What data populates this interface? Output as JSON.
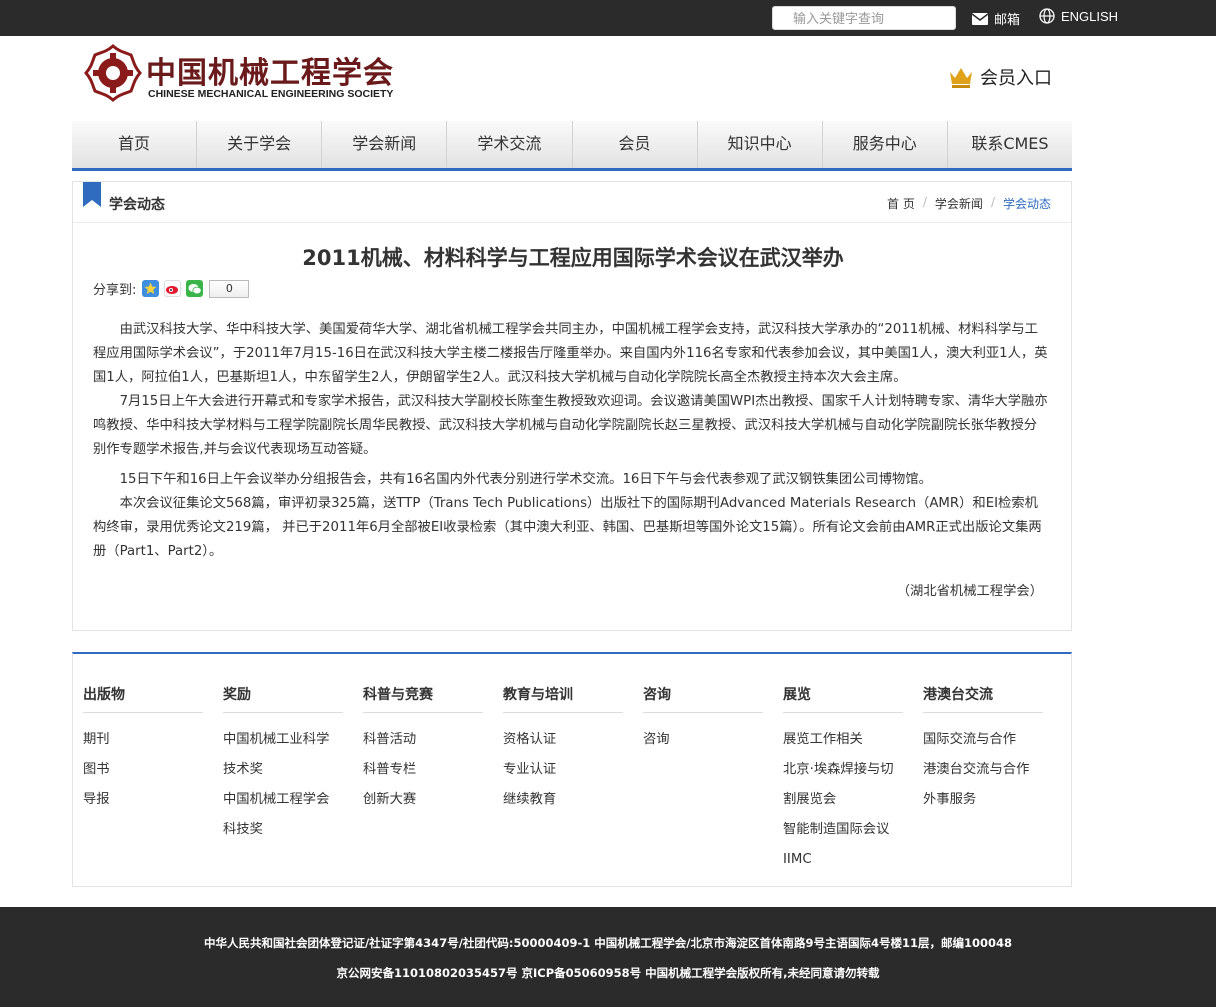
{
  "topbar": {
    "search_placeholder": "输入关键字查询",
    "mail_label": "邮箱",
    "lang_label": "ENGLISH"
  },
  "header": {
    "logo_title": "中国机械工程学会",
    "logo_subtitle": "CHINESE MECHANICAL ENGINEERING SOCIETY",
    "member_entry": "会员入口"
  },
  "nav": {
    "items": [
      "首页",
      "关于学会",
      "学会新闻",
      "学术交流",
      "会员",
      "知识中心",
      "服务中心",
      "联系CMES"
    ]
  },
  "section": {
    "title": "学会动态",
    "breadcrumb": [
      "首 页",
      "学会新闻",
      "学会动态"
    ]
  },
  "article": {
    "title": "2011机械、材料科学与工程应用国际学术会议在武汉举办",
    "share_label": "分享到:",
    "share_count": "0",
    "paragraphs": [
      "由武汉科技大学、华中科技大学、美国爱荷华大学、湖北省机械工程学会共同主办，中国机械工程学会支持，武汉科技大学承办的“2011机械、材料科学与工程应用国际学术会议”，于2011年7月15-16日在武汉科技大学主楼二楼报告厅隆重举办。来自国内外116名专家和代表参加会议，其中美国1人，澳大利亚1人，英国1人，阿拉伯1人，巴基斯坦1人，中东留学生2人，伊朗留学生2人。武汉科技大学机械与自动化学院院长高全杰教授主持本次大会主席。",
      "7月15日上午大会进行开幕式和专家学术报告，武汉科技大学副校长陈奎生教授致欢迎词。会议邀请美国WPI杰出教授、国家千人计划特聘专家、清华大学融亦鸣教授、华中科技大学材料与工程学院副院长周华民教授、武汉科技大学机械与自动化学院副院长赵三星教授、武汉科技大学机械与自动化学院副院长张华教授分别作专题学术报告,并与会议代表现场互动答疑。",
      "15日下午和16日上午会议举办分组报告会，共有16名国内外代表分别进行学术交流。16日下午与会代表参观了武汉钢铁集团公司博物馆。",
      "本次会议征集论文568篇，审评初录325篇，送TTP（Trans Tech Publications）出版社下的国际期刊Advanced Materials Research（AMR）和EI检索机构终审，录用优秀论文219篇， 并已于2011年6月全部被EI收录检索（其中澳大利亚、韩国、巴基斯坦等国外论文15篇）。所有论文会前由AMR正式出版论文集两册（Part1、Part2）。"
    ],
    "signature": "（湖北省机械工程学会）"
  },
  "footer_columns": [
    {
      "title": "出版物",
      "items": [
        "期刊",
        "图书",
        "导报"
      ]
    },
    {
      "title": "奖励",
      "items": [
        "中国机械工业科学",
        "技术奖",
        "中国机械工程学会",
        "科技奖"
      ]
    },
    {
      "title": "科普与竞赛",
      "items": [
        "科普活动",
        "科普专栏",
        "创新大赛"
      ]
    },
    {
      "title": "教育与培训",
      "items": [
        "资格认证",
        "专业认证",
        "继续教育"
      ]
    },
    {
      "title": "咨询",
      "items": [
        "咨询"
      ]
    },
    {
      "title": "展览",
      "items": [
        "展览工作相关",
        "北京·埃森焊接与切",
        "割展览会",
        "智能制造国际会议",
        "IIMC"
      ]
    },
    {
      "title": "港澳台交流",
      "items": [
        "国际交流与合作",
        "港澳台交流与合作",
        "外事服务"
      ]
    }
  ],
  "bottom": {
    "line1": "中华人民共和国社会团体登记证/社证字第4347号/社团代码:50000409-1 中国机械工程学会/北京市海淀区首体南路9号主语国际4号楼11层，邮编100048",
    "line2": "京公网安备11010802035457号 京ICP备05060958号 中国机械工程学会版权所有,未经同意请勿转载"
  },
  "colors": {
    "brand_dark_red": "#6a1a1a",
    "nav_accent_blue": "#2f6cc0",
    "dark_bar": "#2b2b2b"
  }
}
